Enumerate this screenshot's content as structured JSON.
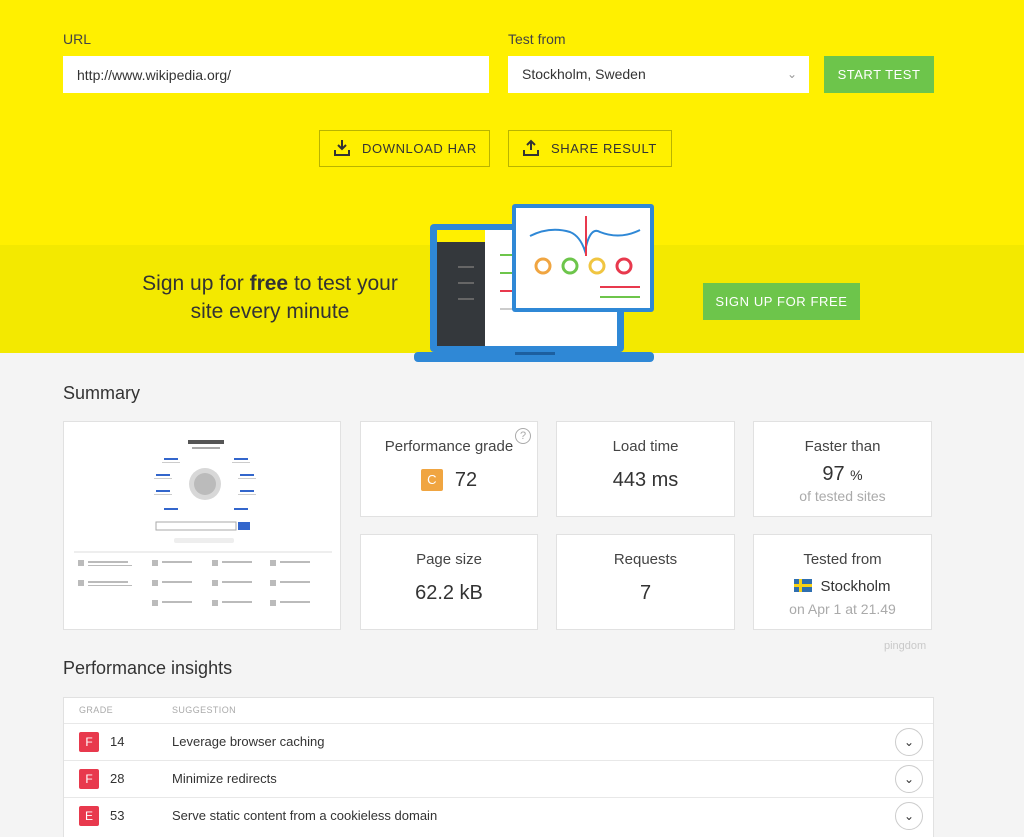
{
  "form": {
    "url_label": "URL",
    "url_value": "http://www.wikipedia.org/",
    "location_label": "Test from",
    "location_value": "Stockholm, Sweden",
    "start_label": "START TEST",
    "download_label": "DOWNLOAD HAR",
    "share_label": "SHARE RESULT"
  },
  "signup": {
    "text_pre": "Sign up for ",
    "text_bold": "free",
    "text_post": " to test your site every minute",
    "button_label": "SIGN UP FOR FREE"
  },
  "summary": {
    "title": "Summary",
    "performance": {
      "label": "Performance grade",
      "grade": "C",
      "score": "72",
      "help": "?"
    },
    "load_time": {
      "label": "Load time",
      "value": "443 ms"
    },
    "faster": {
      "label": "Faster than",
      "value": "97",
      "unit": "%",
      "sub": "of tested sites"
    },
    "page_size": {
      "label": "Page size",
      "value": "62.2 kB"
    },
    "requests": {
      "label": "Requests",
      "value": "7"
    },
    "tested_from": {
      "label": "Tested from",
      "city": "Stockholm",
      "date": "on Apr 1 at 21.49"
    },
    "brand": "pingdom"
  },
  "insights": {
    "title": "Performance insights",
    "col_grade": "GRADE",
    "col_suggestion": "SUGGESTION",
    "rows": [
      {
        "grade": "F",
        "score": "14",
        "suggestion": "Leverage browser caching"
      },
      {
        "grade": "F",
        "score": "28",
        "suggestion": "Minimize redirects"
      },
      {
        "grade": "E",
        "score": "53",
        "suggestion": "Serve static content from a cookieless domain"
      }
    ]
  },
  "colors": {
    "yellow": "#fff000",
    "green": "#6dc54b",
    "grade_c": "#f0a541",
    "grade_bad": "#e8394d"
  }
}
